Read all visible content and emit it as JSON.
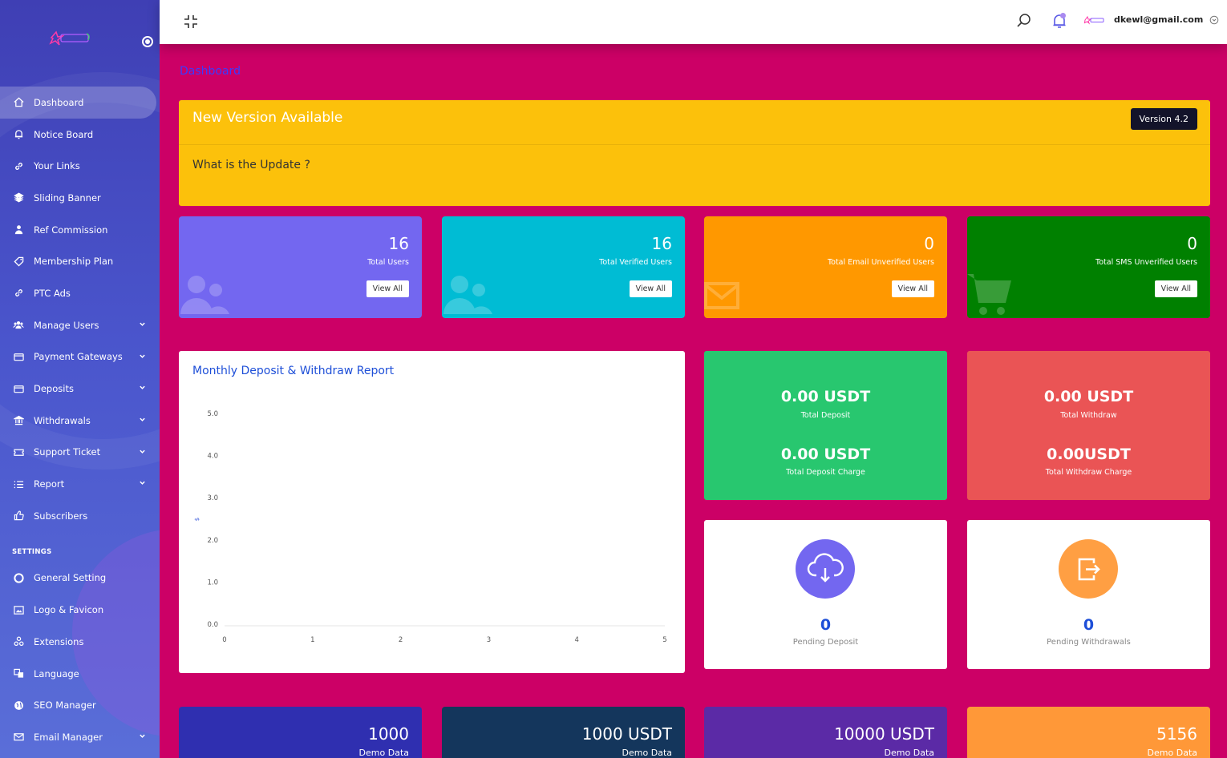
{
  "sidebar": {
    "items": [
      {
        "label": "Dashboard",
        "icon": "home-icon",
        "active": true
      },
      {
        "label": "Notice Board",
        "icon": "bell-icon"
      },
      {
        "label": "Your Links",
        "icon": "link-icon"
      },
      {
        "label": "Sliding Banner",
        "icon": "layers-icon"
      },
      {
        "label": "Ref Commission",
        "icon": "user-tie-icon"
      },
      {
        "label": "Membership Plan",
        "icon": "tag-icon"
      },
      {
        "label": "PTC Ads",
        "icon": "link-icon"
      },
      {
        "label": "Manage Users",
        "icon": "users-icon",
        "expandable": true
      },
      {
        "label": "Payment Gateways",
        "icon": "credit-card-icon",
        "expandable": true
      },
      {
        "label": "Deposits",
        "icon": "credit-card-icon",
        "expandable": true
      },
      {
        "label": "Withdrawals",
        "icon": "bank-icon",
        "expandable": true
      },
      {
        "label": "Support Ticket",
        "icon": "ticket-icon",
        "expandable": true
      },
      {
        "label": "Report",
        "icon": "list-icon",
        "expandable": true
      },
      {
        "label": "Subscribers",
        "icon": "thumbs-up-icon"
      }
    ],
    "settings_heading": "SETTINGS",
    "settings_items": [
      {
        "label": "General Setting",
        "icon": "life-ring-icon"
      },
      {
        "label": "Logo & Favicon",
        "icon": "image-icon"
      },
      {
        "label": "Extensions",
        "icon": "cubes-icon"
      },
      {
        "label": "Language",
        "icon": "language-icon"
      },
      {
        "label": "SEO Manager",
        "icon": "globe-icon"
      },
      {
        "label": "Email Manager",
        "icon": "envelope-icon",
        "expandable": true
      }
    ]
  },
  "topbar": {
    "user_email": "dkewl@gmail.com"
  },
  "page": {
    "title": "Dashboard"
  },
  "update": {
    "title": "New Version Available",
    "version": "Version 4.2",
    "question": "What is the Update ?"
  },
  "stats": [
    {
      "value": "16",
      "label": "Total Users",
      "button": "View All",
      "color": "#7367f0",
      "icon": "users-icon"
    },
    {
      "value": "16",
      "label": "Total Verified Users",
      "button": "View All",
      "color": "#00bcd4",
      "icon": "users-icon"
    },
    {
      "value": "0",
      "label": "Total Email Unverified Users",
      "button": "View All",
      "color": "#ff9800",
      "icon": "envelope-icon"
    },
    {
      "value": "0",
      "label": "Total SMS Unverified Users",
      "button": "View All",
      "color": "#008000",
      "icon": "cart-icon"
    }
  ],
  "chart": {
    "title": "Monthly Deposit & Withdraw Report"
  },
  "chart_data": {
    "type": "line",
    "title": "Monthly Deposit & Withdraw Report",
    "xlabel": "",
    "ylabel": "$",
    "x": [
      0,
      1,
      2,
      3,
      4,
      5
    ],
    "ylim": [
      0,
      5
    ],
    "yticks": [
      "0.0",
      "1.0",
      "2.0",
      "3.0",
      "4.0",
      "5.0"
    ],
    "xticks": [
      "0",
      "1",
      "2",
      "3",
      "4",
      "5"
    ],
    "series": []
  },
  "money": {
    "deposit": {
      "value": "0.00 USDT",
      "label": "Total Deposit",
      "charge_value": "0.00 USDT",
      "charge_label": "Total Deposit Charge",
      "color": "#28c76f"
    },
    "withdraw": {
      "value": "0.00 USDT",
      "label": "Total Withdraw",
      "charge_value": "0.00USDT",
      "charge_label": "Total Withdraw Charge",
      "color": "#ea5455"
    }
  },
  "pending": {
    "deposit": {
      "value": "0",
      "label": "Pending Deposit",
      "color": "#7367f0",
      "icon": "cloud-download-icon"
    },
    "withdraw": {
      "value": "0",
      "label": "Pending Withdrawals",
      "color": "#ff9f43",
      "icon": "sign-out-icon"
    }
  },
  "demo": [
    {
      "value": "1000",
      "label": "Demo Data",
      "color": "#2f2fb0"
    },
    {
      "value": "1000 USDT",
      "label": "Demo Data",
      "color": "#14365c"
    },
    {
      "value": "10000 USDT",
      "label": "Demo Data",
      "color": "#5b2aa6"
    },
    {
      "value": "5156",
      "label": "Demo Data",
      "color": "#ff9838"
    }
  ]
}
